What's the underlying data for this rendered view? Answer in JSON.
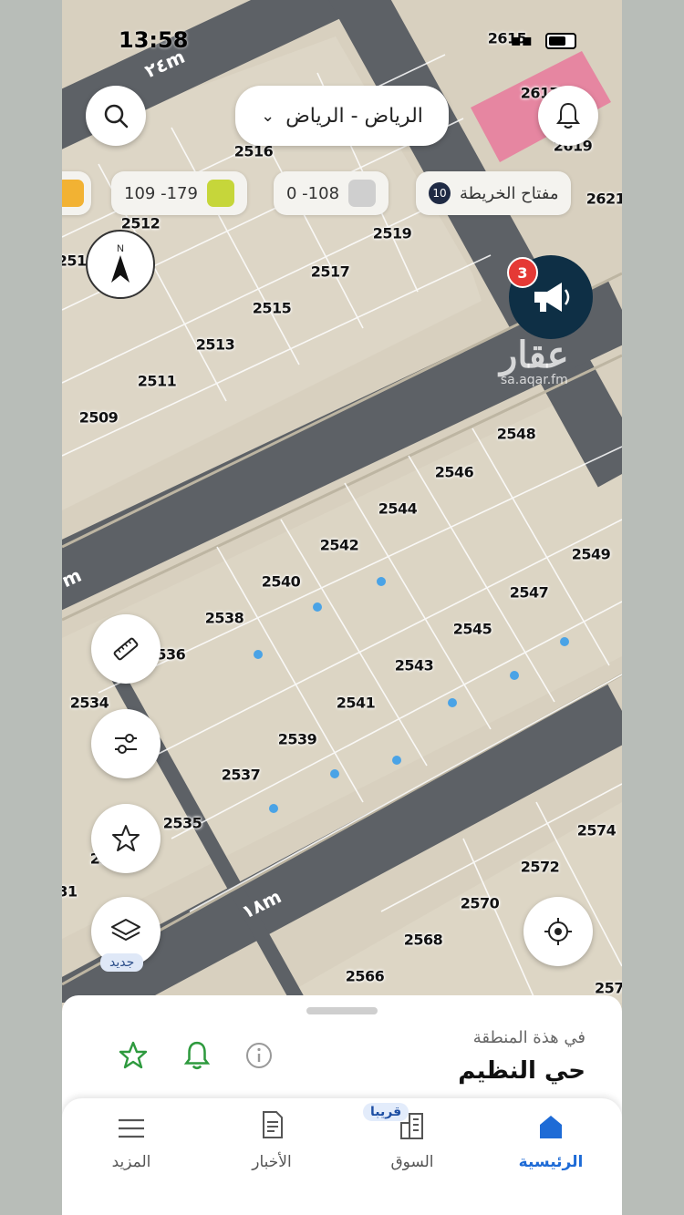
{
  "status": {
    "time": "13:58"
  },
  "header": {
    "city": "الرياض - الرياض"
  },
  "legend": {
    "map_key_label": "مفتاح الخريطة",
    "map_key_count": "10",
    "chips": [
      {
        "label": "0 -108",
        "color": "#cfcfcf"
      },
      {
        "label": "109 -179",
        "color": "#c6d63a"
      },
      {
        "label": "",
        "color": "#f2b233"
      }
    ]
  },
  "promo": {
    "badge": "3"
  },
  "watermark": {
    "brand": "عقار",
    "url": "sa.aqar.fm"
  },
  "map": {
    "roads": [
      "٢٤m",
      "١٨m",
      "m"
    ],
    "plots": [
      {
        "n": "2615"
      },
      {
        "n": "2617"
      },
      {
        "n": "2619"
      },
      {
        "n": "2621"
      },
      {
        "n": "2516"
      },
      {
        "n": "2514"
      },
      {
        "n": "2512"
      },
      {
        "n": "2510"
      },
      {
        "n": "2519"
      },
      {
        "n": "2517"
      },
      {
        "n": "2515"
      },
      {
        "n": "2513"
      },
      {
        "n": "2511"
      },
      {
        "n": "2509"
      },
      {
        "n": "2548"
      },
      {
        "n": "2546"
      },
      {
        "n": "2544"
      },
      {
        "n": "2542"
      },
      {
        "n": "2549"
      },
      {
        "n": "2540"
      },
      {
        "n": "2547"
      },
      {
        "n": "2538"
      },
      {
        "n": "2545"
      },
      {
        "n": "2536"
      },
      {
        "n": "2543"
      },
      {
        "n": "2534"
      },
      {
        "n": "2541"
      },
      {
        "n": "2539"
      },
      {
        "n": "2537"
      },
      {
        "n": "2535"
      },
      {
        "n": "2533"
      },
      {
        "n": "2574"
      },
      {
        "n": "2572"
      },
      {
        "n": "2570"
      },
      {
        "n": "2568"
      },
      {
        "n": "2566"
      },
      {
        "n": "257"
      },
      {
        "n": "31"
      }
    ]
  },
  "controls": {
    "new_tag": "جديد"
  },
  "sheet": {
    "subtitle": "في هذة المنطقة",
    "title": "حي النظيم"
  },
  "tabs": [
    {
      "label": "الرئيسية",
      "active": true
    },
    {
      "label": "السوق",
      "badge": "قريبا"
    },
    {
      "label": "الأخبار"
    },
    {
      "label": "المزيد"
    }
  ]
}
